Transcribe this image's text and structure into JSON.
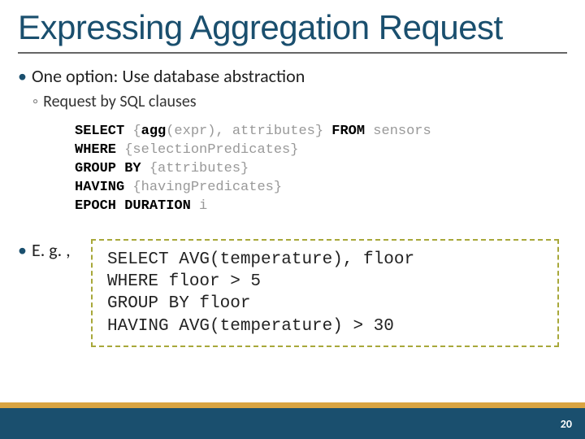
{
  "title": "Expressing Aggregation Request",
  "bullet1": "One option: Use database abstraction",
  "bullet2": "Request by SQL clauses",
  "template": {
    "l1_a": "SELECT",
    "l1_b": " {",
    "l1_c": "agg",
    "l1_d": "(expr), attributes} ",
    "l1_e": "FROM",
    "l1_f": " sensors",
    "l2_a": "WHERE",
    "l2_b": " {selectionPredicates}",
    "l3_a": "GROUP BY",
    "l3_b": " {attributes}",
    "l4_a": "HAVING",
    "l4_b": " {havingPredicates}",
    "l5_a": "EPOCH DURATION",
    "l5_b": " i"
  },
  "eg_label": "E. g. ,",
  "example": "SELECT AVG(temperature), floor\nWHERE floor > 5\nGROUP BY floor\nHAVING AVG(temperature) > 30",
  "page": "20"
}
